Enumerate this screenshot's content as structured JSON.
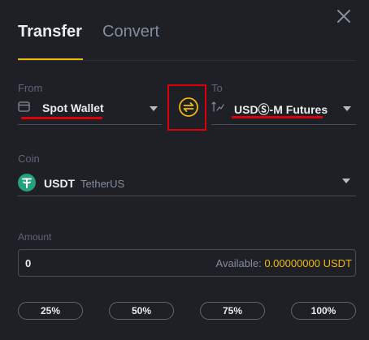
{
  "tabs": {
    "transfer": "Transfer",
    "convert": "Convert"
  },
  "from": {
    "label": "From",
    "wallet": "Spot Wallet",
    "icon": "wallet-icon"
  },
  "to": {
    "label": "To",
    "wallet": "USDⓈ-M Futures",
    "icon": "futures-icon"
  },
  "coin": {
    "label": "Coin",
    "symbol": "USDT",
    "name": "TetherUS",
    "icon": "tether-icon"
  },
  "amount": {
    "label": "Amount",
    "value": "0",
    "available_label": "Available:",
    "available_value": "0.00000000 USDT"
  },
  "percent_buttons": [
    "25%",
    "50%",
    "75%",
    "100%"
  ],
  "colors": {
    "background": "#1e2026",
    "accent": "#f0b90b",
    "tether": "#26a17b",
    "highlight_red": "#e0000b",
    "muted_text": "#848e9c"
  }
}
